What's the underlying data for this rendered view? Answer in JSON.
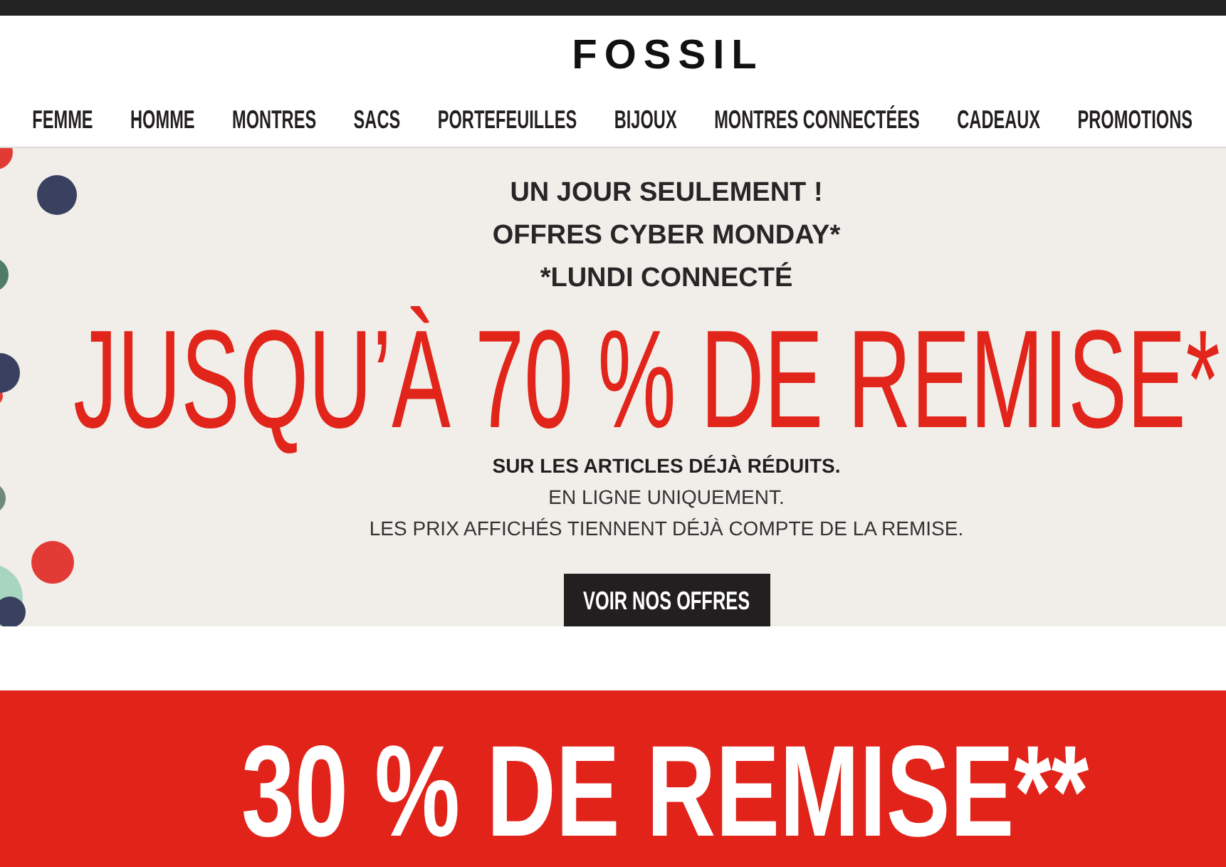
{
  "header": {
    "logo": "FOSSIL"
  },
  "nav": {
    "items": [
      "FEMME",
      "HOMME",
      "MONTRES",
      "SACS",
      "PORTEFEUILLES",
      "BIJOUX",
      "MONTRES CONNECTÉES",
      "CADEAUX",
      "PROMOTIONS"
    ]
  },
  "hero": {
    "taglines": [
      "UN JOUR SEULEMENT !",
      "OFFRES CYBER MONDAY*",
      "*LUNDI CONNECTÉ"
    ],
    "headline": "JUSQU’À 70 % DE REMISE*",
    "details": [
      {
        "text": "SUR LES ARTICLES DÉJÀ RÉDUITS.",
        "kind": "bold"
      },
      {
        "text": "EN LIGNE UNIQUEMENT.",
        "kind": "plain"
      },
      {
        "text": "LES PRIX AFFICHÉS TIENNENT DÉJÀ COMPTE DE LA REMISE.",
        "kind": "plain"
      }
    ],
    "button": "VOIR NOS OFFRES"
  },
  "promo_band": {
    "headline": "30 % DE REMISE**"
  }
}
